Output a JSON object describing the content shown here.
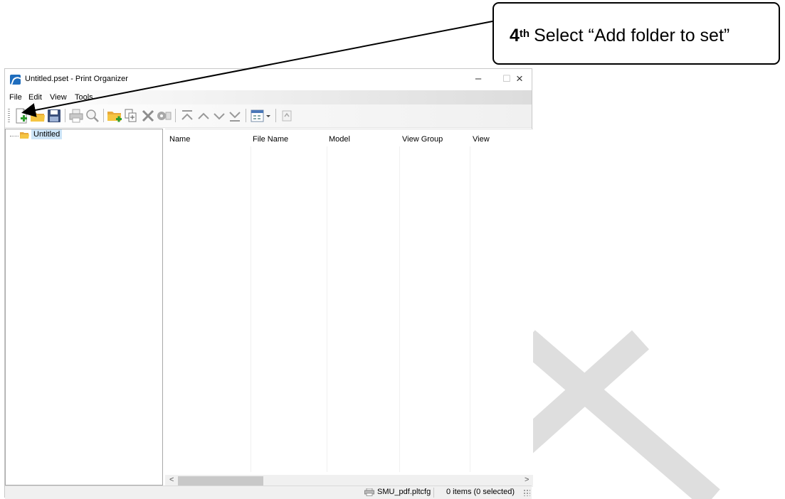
{
  "callout": {
    "number": "4",
    "suffix": "th",
    "text": "Select “Add folder to set”"
  },
  "window": {
    "title": "Untitled.pset - Print Organizer",
    "controls": {
      "minimize": "–",
      "maximize": "☐",
      "close": "×"
    }
  },
  "menu": [
    "File",
    "Edit",
    "View",
    "Tools"
  ],
  "toolbar_icons": [
    "new-set-icon",
    "open-icon",
    "save-icon",
    "print-icon",
    "preview-icon",
    "add-folder-icon",
    "add-files-icon",
    "delete-icon",
    "properties-icon",
    "move-top-icon",
    "move-up-icon",
    "move-down-icon",
    "move-bottom-icon",
    "display-options-icon",
    "export-icon"
  ],
  "tree": {
    "root_label": "Untitled"
  },
  "list": {
    "columns": [
      "Name",
      "File Name",
      "Model",
      "View Group",
      "View"
    ],
    "scroll_left": "<",
    "scroll_right": ">"
  },
  "status": {
    "config": "SMU_pdf.pltcfg",
    "items": "0 items (0 selected)"
  },
  "colors": {
    "selection": "#cce4f7",
    "app_icon": "#1f6dbd",
    "folder": "#f5c542",
    "add_green": "#2e9b2e"
  }
}
